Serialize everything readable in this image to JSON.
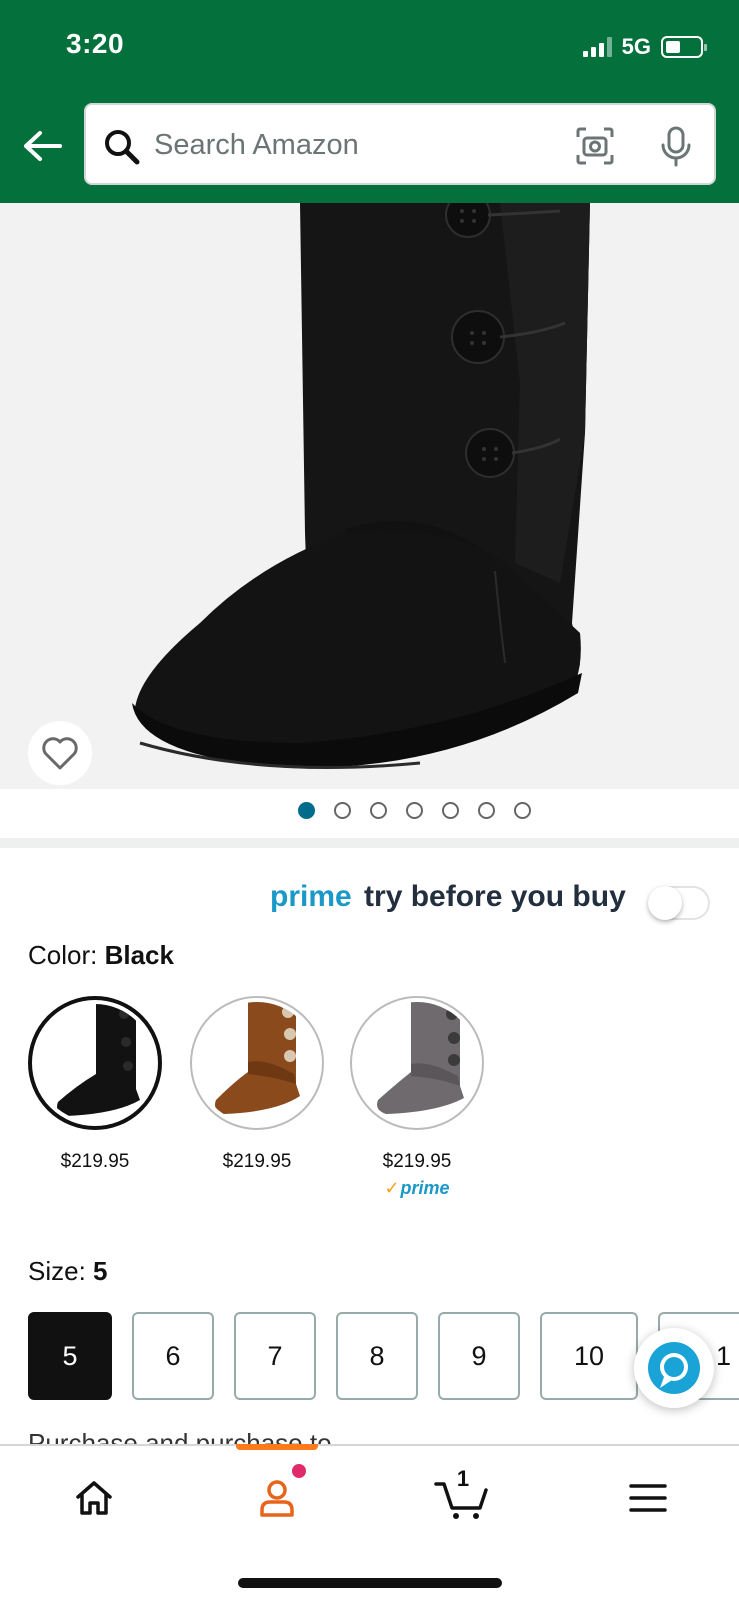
{
  "status_bar": {
    "time": "3:20",
    "network": "5G"
  },
  "search": {
    "placeholder": "Search Amazon"
  },
  "product": {
    "image_dots_count": 7,
    "active_dot": 0
  },
  "prime_try": {
    "brand": "prime",
    "text": "try before you buy",
    "enabled": false
  },
  "color": {
    "label": "Color: ",
    "selected": "Black",
    "options": [
      {
        "name": "Black",
        "price": "$219.95",
        "prime": ""
      },
      {
        "name": "Chestnut",
        "price": "$219.95",
        "prime": ""
      },
      {
        "name": "Grey",
        "price": "$219.95",
        "prime": "prime"
      }
    ]
  },
  "size": {
    "label": "Size: ",
    "selected": "5",
    "options": [
      "5",
      "6",
      "7",
      "8",
      "9",
      "10",
      "1"
    ]
  },
  "cut_text": "Purchase and purchase to ...",
  "bottom_nav": {
    "items": [
      "home",
      "account",
      "cart",
      "menu"
    ],
    "active": "account",
    "cart_count": "1"
  },
  "colors": {
    "header_bg": "#04713c",
    "prime_blue": "#1a98c8",
    "accent_orange": "#ff7a1a",
    "dot_active": "#006c8c"
  }
}
